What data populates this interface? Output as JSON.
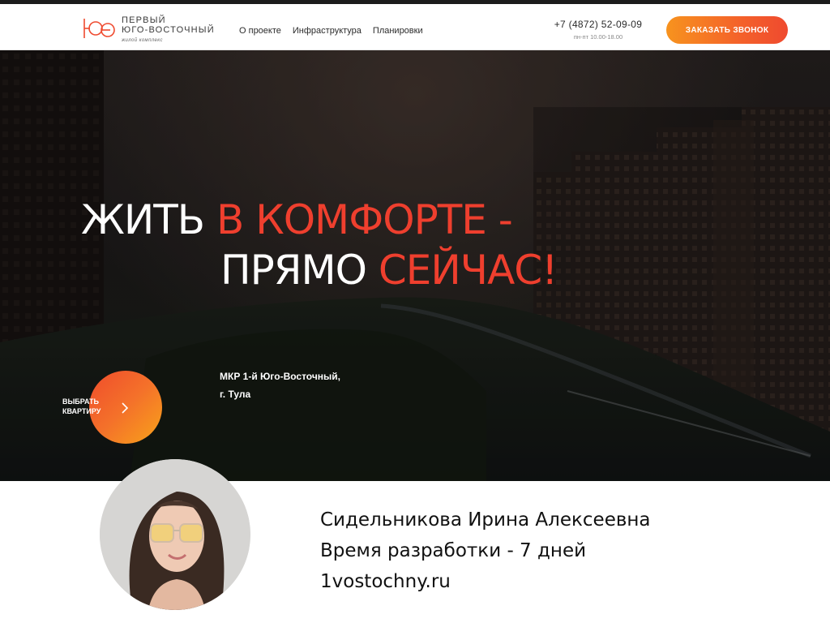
{
  "header": {
    "logo": {
      "mark": "ЮЭ",
      "line1": "ПЕРВЫЙ",
      "line2": "ЮГО-ВОСТОЧНЫЙ",
      "sub": "жилой комплекс"
    },
    "nav": [
      {
        "label": "О проекте"
      },
      {
        "label": "Инфраструктура"
      },
      {
        "label": "Планировки"
      }
    ],
    "phone": "+7 (4872) 52-09-09",
    "hours": "пн-пт 10.00-18.00",
    "callback_label": "ЗАКАЗАТЬ ЗВОНОК"
  },
  "hero": {
    "headline_1_white": "ЖИТЬ ",
    "headline_1_red": "В КОМФОРТЕ -",
    "headline_2_white": "ПРЯМО ",
    "headline_2_red": "СЕЙЧАС!",
    "address_line1": "МКР 1-й Юго-Восточный,",
    "address_line2": "г. Тула",
    "choose_line1": "ВЫБРАТЬ",
    "choose_line2": "КВАРТИРУ"
  },
  "info": {
    "name": "Сидельникова Ирина Алексеевна",
    "dev_time": "Время разработки - 7 дней",
    "site": "1vostochny.ru"
  },
  "colors": {
    "accent_red": "#ef3f2e",
    "accent_orange": "#f7931e",
    "hero_bg": "#1d1b1b"
  },
  "icons": {
    "logo": "logo-icon",
    "chevron": "chevron-right-icon",
    "avatar": "avatar-photo"
  }
}
